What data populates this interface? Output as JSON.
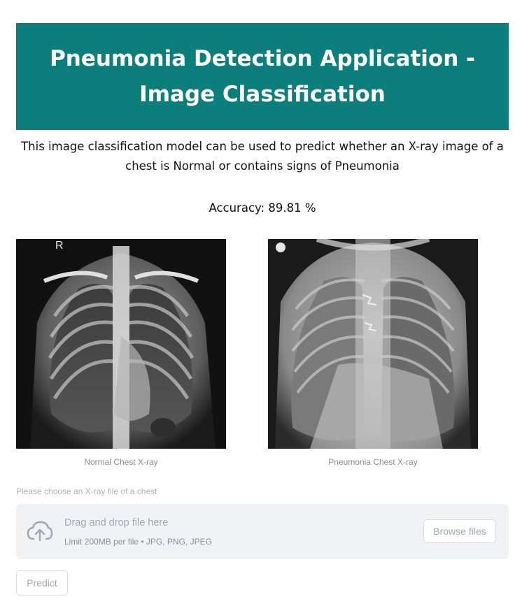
{
  "header": {
    "title": "Pneumonia Detection Application - Image Classification"
  },
  "description": "This image classification model can be used to predict whether an X-ray image of a chest is Normal or contains signs of Pneumonia",
  "accuracy_text": "Accuracy: 89.81 %",
  "images": [
    {
      "caption": "Normal Chest X-ray",
      "marker": "R"
    },
    {
      "caption": "Pneumonia Chest X-ray"
    }
  ],
  "uploader": {
    "label": "Please choose an X-ray file of a chest",
    "title": "Drag and drop file here",
    "limit": "Limit 200MB per file • JPG, PNG, JPEG",
    "browse_label": "Browse files",
    "icon": "cloud-upload-icon"
  },
  "actions": {
    "predict_label": "Predict"
  },
  "colors": {
    "banner": "#0c7f7d",
    "dropzone": "#f0f2f6"
  }
}
